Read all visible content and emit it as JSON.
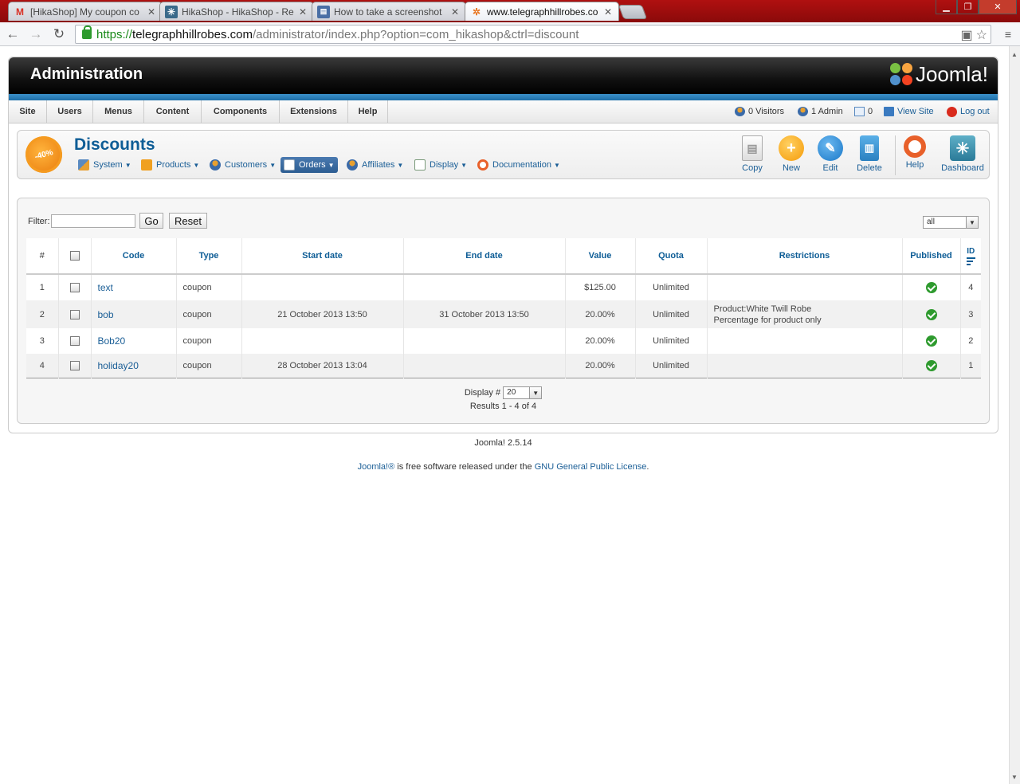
{
  "browser": {
    "tabs": [
      {
        "title": "[HikaShop] My coupon co",
        "favicon": "gmail-icon",
        "favicon_color": "#d93025"
      },
      {
        "title": "HikaShop - HikaShop - Re",
        "favicon": "hikashop-icon",
        "favicon_color": "#3a6a8a"
      },
      {
        "title": "How to take a screenshot",
        "favicon": "page-icon",
        "favicon_color": "#4a6fa5"
      },
      {
        "title": "www.telegraphhillrobes.co",
        "favicon": "joomla-icon",
        "favicon_color": "#e87722"
      }
    ],
    "url": {
      "scheme": "https://",
      "host": "telegraphhillrobes.com",
      "path": "/administrator/index.php?option=com_hikashop&ctrl=discount"
    }
  },
  "admin": {
    "header_title": "Administration",
    "logo_text": "Joomla!",
    "menu": [
      "Site",
      "Users",
      "Menus",
      "Content",
      "Components",
      "Extensions",
      "Help"
    ],
    "status": {
      "visitors": "0 Visitors",
      "admins": "1 Admin",
      "messages": "0",
      "view_site": "View Site",
      "logout": "Log out"
    }
  },
  "page": {
    "title": "Discounts",
    "badge_text": "-40%",
    "submenu": [
      "System",
      "Products",
      "Customers",
      "Orders",
      "Affiliates",
      "Display",
      "Documentation"
    ],
    "active_submenu": "Orders",
    "toolbar": {
      "copy": "Copy",
      "new": "New",
      "edit": "Edit",
      "delete": "Delete",
      "help": "Help",
      "dashboard": "Dashboard"
    }
  },
  "filter": {
    "label": "Filter:",
    "value": "",
    "go": "Go",
    "reset": "Reset",
    "published_select": "all"
  },
  "table": {
    "headers": {
      "num": "#",
      "code": "Code",
      "type": "Type",
      "start": "Start date",
      "end": "End date",
      "value": "Value",
      "quota": "Quota",
      "restrictions": "Restrictions",
      "published": "Published",
      "id": "ID"
    },
    "rows": [
      {
        "num": "1",
        "code": "text",
        "type": "coupon",
        "start": "",
        "end": "",
        "value": "$125.00",
        "quota": "Unlimited",
        "restr1": "",
        "restr2": "",
        "id": "4"
      },
      {
        "num": "2",
        "code": "bob",
        "type": "coupon",
        "start": "21 October 2013 13:50",
        "end": "31 October 2013 13:50",
        "value": "20.00%",
        "quota": "Unlimited",
        "restr1": "Product:White Twill Robe",
        "restr2": "Percentage for product only",
        "id": "3"
      },
      {
        "num": "3",
        "code": "Bob20",
        "type": "coupon",
        "start": "",
        "end": "",
        "value": "20.00%",
        "quota": "Unlimited",
        "restr1": "",
        "restr2": "",
        "id": "2"
      },
      {
        "num": "4",
        "code": "holiday20",
        "type": "coupon",
        "start": "28 October 2013 13:04",
        "end": "",
        "value": "20.00%",
        "quota": "Unlimited",
        "restr1": "",
        "restr2": "",
        "id": "1"
      }
    ]
  },
  "pager": {
    "display_label": "Display #",
    "display_value": "20",
    "results": "Results 1 - 4 of 4"
  },
  "footer": {
    "version": "Joomla! 2.5.14",
    "license_link1": "Joomla!®",
    "license_text": " is free software released under the ",
    "license_link2": "GNU General Public License",
    "license_end": "."
  }
}
